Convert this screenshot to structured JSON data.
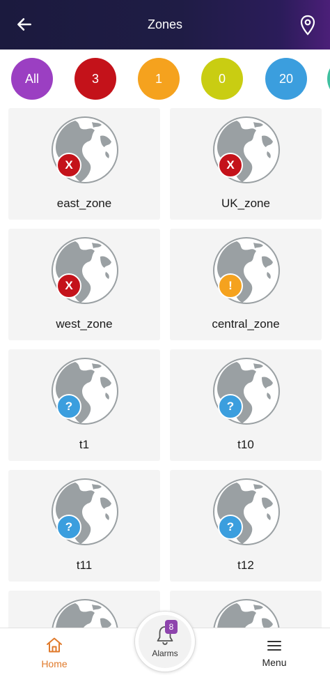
{
  "header": {
    "title": "Zones",
    "back_icon": "arrow-left-icon",
    "location_icon": "location-pin-icon"
  },
  "filters": [
    {
      "label": "All",
      "color": "#9b3fc2"
    },
    {
      "label": "3",
      "color": "#c4121a"
    },
    {
      "label": "1",
      "color": "#f5a21e"
    },
    {
      "label": "0",
      "color": "#c9cd12"
    },
    {
      "label": "20",
      "color": "#3b9ede"
    }
  ],
  "zones": [
    {
      "name": "east_zone",
      "status": "critical",
      "badge": "X",
      "color": "#c4121a"
    },
    {
      "name": "UK_zone",
      "status": "critical",
      "badge": "X",
      "color": "#c4121a"
    },
    {
      "name": "west_zone",
      "status": "critical",
      "badge": "X",
      "color": "#c4121a"
    },
    {
      "name": "central_zone",
      "status": "warning",
      "badge": "!",
      "color": "#f5a21e"
    },
    {
      "name": "t1",
      "status": "unknown",
      "badge": "?",
      "color": "#3b9ede"
    },
    {
      "name": "t10",
      "status": "unknown",
      "badge": "?",
      "color": "#3b9ede"
    },
    {
      "name": "t11",
      "status": "unknown",
      "badge": "?",
      "color": "#3b9ede"
    },
    {
      "name": "t12",
      "status": "unknown",
      "badge": "?",
      "color": "#3b9ede"
    },
    {
      "name": "",
      "status": "",
      "badge": "",
      "color": ""
    },
    {
      "name": "",
      "status": "",
      "badge": "",
      "color": ""
    }
  ],
  "bottom_nav": {
    "home_label": "Home",
    "alarms_label": "Alarms",
    "alarms_count": "8",
    "menu_label": "Menu",
    "home_color": "#e07a2b"
  }
}
